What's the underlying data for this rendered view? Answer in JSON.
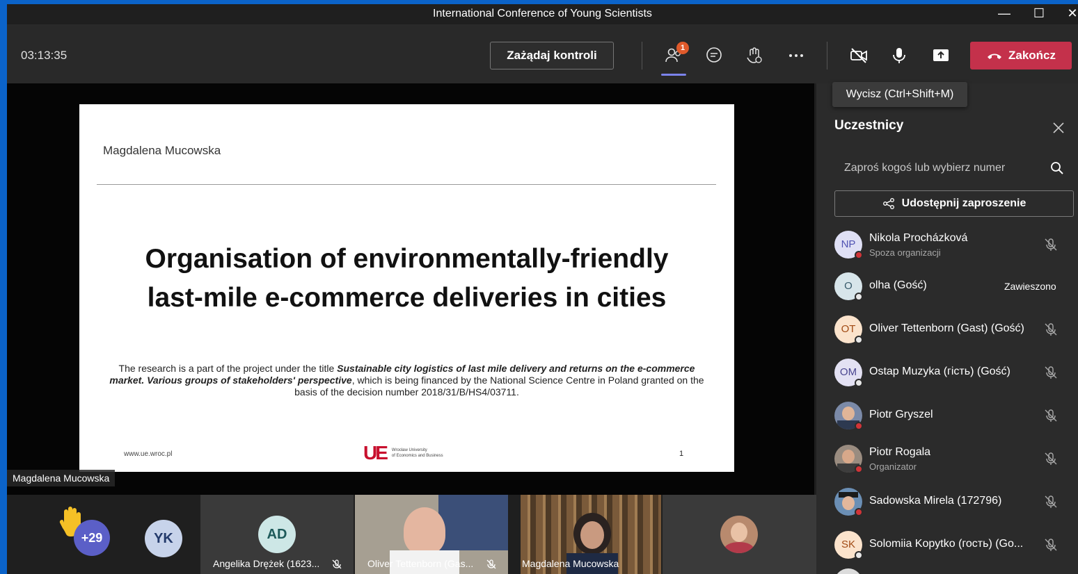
{
  "window": {
    "title": "International Conference of Young Scientists"
  },
  "toolbar": {
    "timer": "03:13:35",
    "request_control_label": "Zażądaj kontroli",
    "participants_badge": "1",
    "end_label": "Zakończ",
    "end_color": "#c4314b"
  },
  "tooltip": "Wycisz (Ctrl+Shift+M)",
  "slide": {
    "author": "Magdalena Mucowska",
    "heading_line1": "Organisation of  environmentally-friendly",
    "heading_line2": "last-mile e-commerce deliveries in cities",
    "body_prefix": "The research is a part of the project under the title ",
    "body_title": "Sustainable city logistics of last mile delivery and returns on the e-commerce market. Various groups of stakeholders' perspective",
    "body_suffix": ", which is being financed by the National Science Centre in Poland granted on the basis of the decision number 2018/31/B/HS4/03711.",
    "footer_url": "www.ue.wroc.pl",
    "logo_mark": "UE",
    "logo_text_line1": "Wrocław University",
    "logo_text_line2": "of Economics and Business",
    "page_number": "1"
  },
  "presenter_tag": "Magdalena Mucowska",
  "strip": {
    "overflow_count": "+29",
    "tiles": [
      {
        "initials": "YK",
        "label": ""
      },
      {
        "initials": "AD",
        "label": "Angelika Drężek (1623..."
      },
      {
        "initials": "",
        "label": "Oliver Tettenborn (Gas..."
      },
      {
        "initials": "",
        "label": "Magdalena Mucowska"
      }
    ]
  },
  "panel": {
    "title": "Uczestnicy",
    "invite_placeholder": "Zaproś kogoś lub wybierz numer",
    "share_label": "Udostępnij zaproszenie",
    "participants": [
      {
        "initials": "NP",
        "name": "Nikola Procházková",
        "sub": "Spoza organizacji",
        "state": ""
      },
      {
        "initials": "O",
        "name": "olha (Gość)",
        "sub": "",
        "state": "Zawieszono"
      },
      {
        "initials": "OT",
        "name": "Oliver Tettenborn (Gast) (Gość)",
        "sub": "",
        "state": ""
      },
      {
        "initials": "OM",
        "name": "Ostap Muzyka (гість) (Gość)",
        "sub": "",
        "state": ""
      },
      {
        "initials": "",
        "name": "Piotr Gryszel",
        "sub": "",
        "state": ""
      },
      {
        "initials": "",
        "name": "Piotr Rogala",
        "sub": "Organizator",
        "state": ""
      },
      {
        "initials": "",
        "name": "Sadowska Mirela (172796)",
        "sub": "",
        "state": ""
      },
      {
        "initials": "SK",
        "name": "Solomiia Kopytko (гость) (Go...",
        "sub": "",
        "state": ""
      }
    ]
  }
}
